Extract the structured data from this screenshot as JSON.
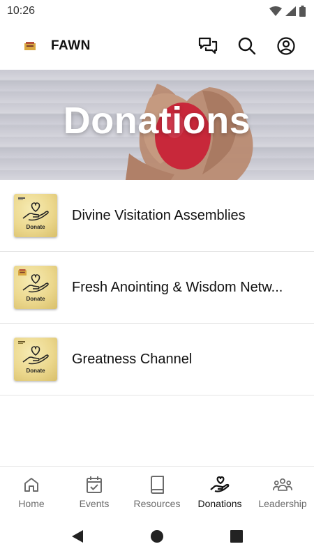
{
  "status_bar": {
    "time": "10:26"
  },
  "app_bar": {
    "title": "FAWN"
  },
  "hero": {
    "title": "Donations"
  },
  "donations": [
    {
      "name": "Divine Visitation Assemblies",
      "thumb_label": "Donate"
    },
    {
      "name": "Fresh Anointing & Wisdom Netw...",
      "thumb_label": "Donate"
    },
    {
      "name": "Greatness Channel",
      "thumb_label": "Donate"
    }
  ],
  "bottom_nav": [
    {
      "label": "Home",
      "icon": "home-icon",
      "active": false
    },
    {
      "label": "Events",
      "icon": "calendar-check-icon",
      "active": false
    },
    {
      "label": "Resources",
      "icon": "book-icon",
      "active": false
    },
    {
      "label": "Donations",
      "icon": "hand-heart-icon",
      "active": true
    },
    {
      "label": "Leadership",
      "icon": "group-icon",
      "active": false
    }
  ],
  "colors": {
    "active_nav": "#111111",
    "inactive_nav": "#6b6b6b",
    "thumb_gold": "#ecd88e",
    "heart_red": "#c8283a"
  }
}
